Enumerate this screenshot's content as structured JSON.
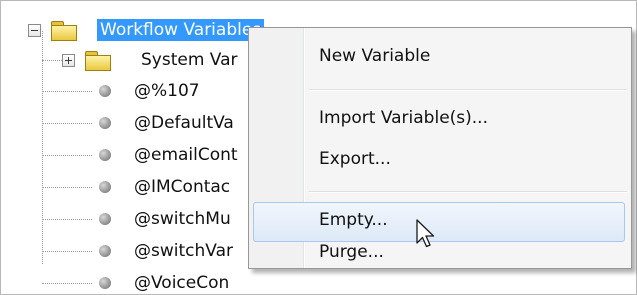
{
  "tree": {
    "root": {
      "label": "Workflow Variables",
      "expanded": true,
      "selected": true
    },
    "children": [
      {
        "label": "System Var",
        "type": "folder",
        "expanded": false
      },
      {
        "label": "@%107",
        "type": "variable"
      },
      {
        "label": "@DefaultVa",
        "type": "variable"
      },
      {
        "label": "@emailCont",
        "type": "variable"
      },
      {
        "label": "@IMContac",
        "type": "variable"
      },
      {
        "label": "@switchMu",
        "type": "variable"
      },
      {
        "label": "@switchVar",
        "type": "variable"
      },
      {
        "label": "@VoiceCon",
        "type": "variable"
      }
    ]
  },
  "context_menu": {
    "items": [
      {
        "label": "New Variable"
      },
      {
        "label": "Import Variable(s)..."
      },
      {
        "label": "Export..."
      },
      {
        "label": "Empty...",
        "highlighted": true
      },
      {
        "label": "Purge..."
      }
    ]
  },
  "colors": {
    "selection": "#3399ff",
    "menu_background": "#f5f5f5",
    "menu_hover_border": "#a9c8ee"
  },
  "icons": {
    "root_expander": "minus-box-icon",
    "folder_expander": "plus-box-icon",
    "folder": "folder-icon",
    "variable": "variable-dot-icon",
    "cursor": "arrow-cursor-icon"
  }
}
